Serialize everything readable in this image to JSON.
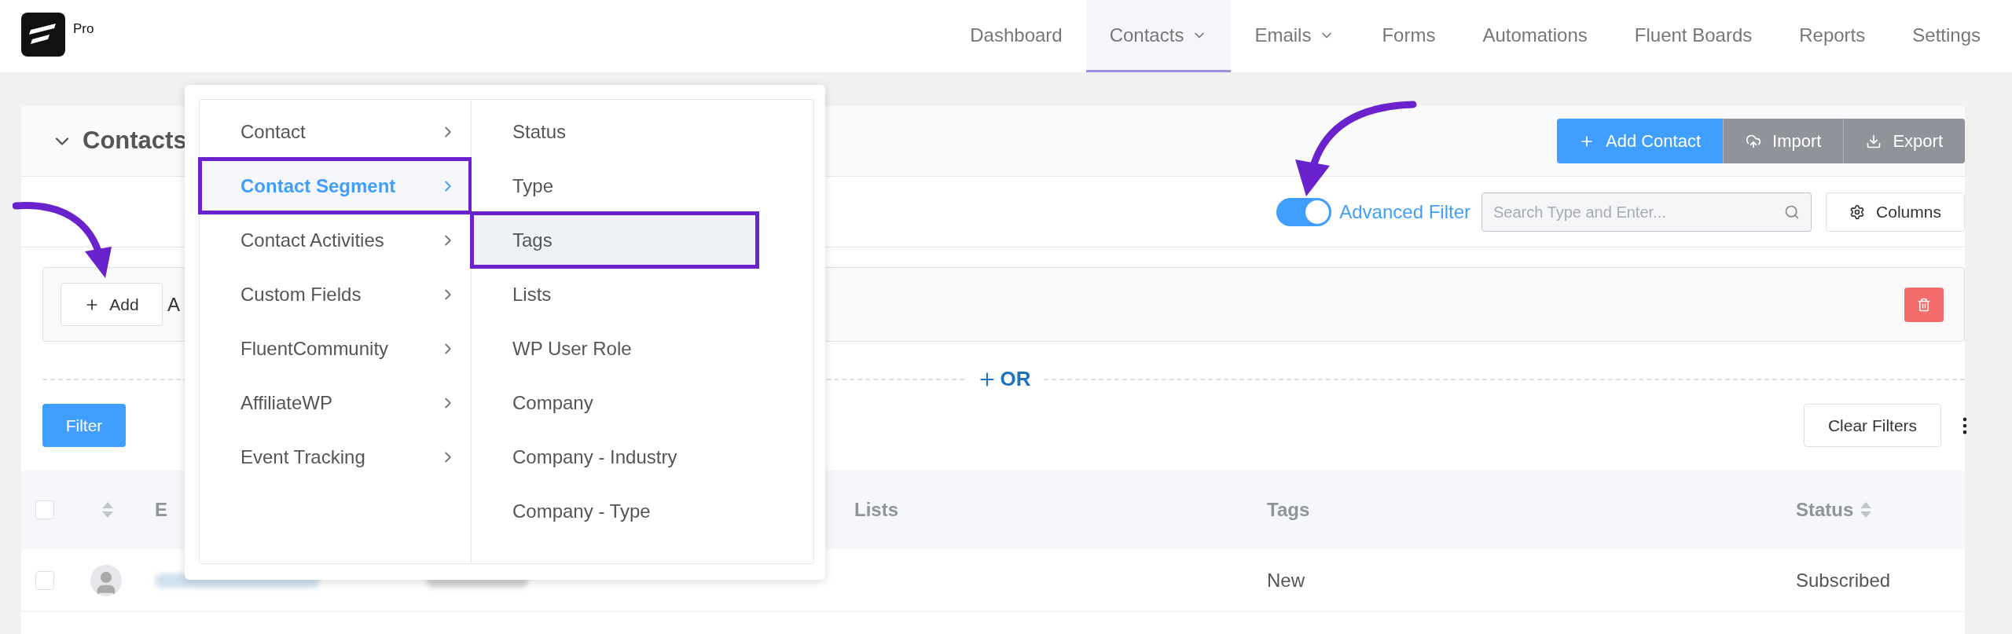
{
  "brand": {
    "badge": "Pro"
  },
  "nav": [
    {
      "label": "Dashboard",
      "selected": false,
      "dropdown": false
    },
    {
      "label": "Contacts",
      "selected": true,
      "dropdown": true
    },
    {
      "label": "Emails",
      "selected": false,
      "dropdown": true
    },
    {
      "label": "Forms",
      "selected": false,
      "dropdown": false
    },
    {
      "label": "Automations",
      "selected": false,
      "dropdown": false
    },
    {
      "label": "Fluent Boards",
      "selected": false,
      "dropdown": false
    },
    {
      "label": "Reports",
      "selected": false,
      "dropdown": false
    },
    {
      "label": "Settings",
      "selected": false,
      "dropdown": false
    }
  ],
  "header": {
    "title": "Contacts",
    "actions": [
      {
        "label": "Add Contact",
        "kind": "primary"
      },
      {
        "label": "Import",
        "kind": "upload"
      },
      {
        "label": "Export",
        "kind": "download"
      }
    ]
  },
  "toolbar": {
    "advanced_filter": {
      "label": "Advanced Filter",
      "on": true
    },
    "search": {
      "placeholder": "Search Type and Enter..."
    },
    "columns_button": "Columns"
  },
  "filter_group": {
    "add_button": "Add",
    "add_label": "A"
  },
  "or_button": "OR",
  "filter_button": "Filter",
  "clear_filters": "Clear Filters",
  "table": {
    "header_checked": false,
    "columns": [
      {
        "label": "E",
        "sortable": false
      },
      {
        "label": "Lists",
        "sortable": false
      },
      {
        "label": "Tags",
        "sortable": false
      },
      {
        "label": "Status",
        "sortable": true
      }
    ],
    "rows": [
      {
        "checked": false,
        "tags": "New",
        "status": "Subscribed"
      }
    ]
  },
  "dropdown": {
    "categories": [
      {
        "label": "Contact",
        "selected": false,
        "annotated": false
      },
      {
        "label": "Contact Segment",
        "selected": true,
        "annotated": true
      },
      {
        "label": "Contact Activities",
        "selected": false,
        "annotated": false
      },
      {
        "label": "Custom Fields",
        "selected": false,
        "annotated": false
      },
      {
        "label": "FluentCommunity",
        "selected": false,
        "annotated": false
      },
      {
        "label": "AffiliateWP",
        "selected": false,
        "annotated": false
      },
      {
        "label": "Event Tracking",
        "selected": false,
        "annotated": false
      }
    ],
    "options": [
      {
        "label": "Status",
        "hovered": false,
        "annotated": false
      },
      {
        "label": "Type",
        "hovered": false,
        "annotated": false
      },
      {
        "label": "Tags",
        "hovered": true,
        "annotated": true
      },
      {
        "label": "Lists",
        "hovered": false,
        "annotated": false
      },
      {
        "label": "WP User Role",
        "hovered": false,
        "annotated": false
      },
      {
        "label": "Company",
        "hovered": false,
        "annotated": false
      },
      {
        "label": "Company - Industry",
        "hovered": false,
        "annotated": false
      },
      {
        "label": "Company - Type",
        "hovered": false,
        "annotated": false
      }
    ]
  }
}
